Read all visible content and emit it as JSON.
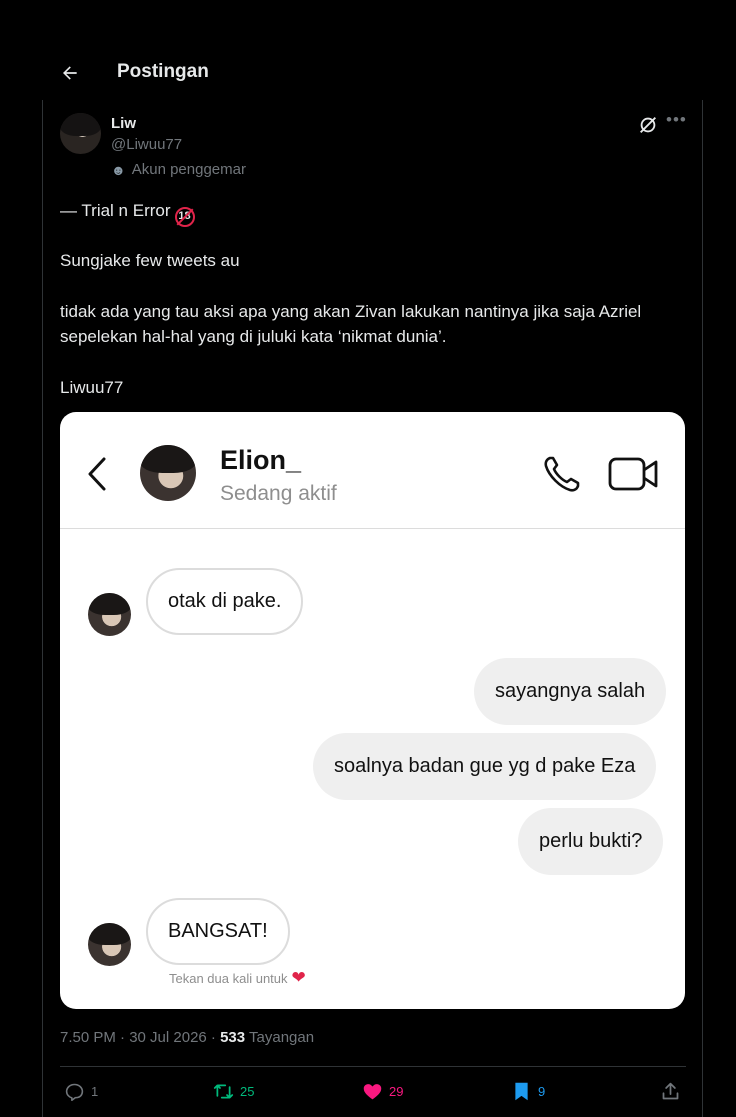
{
  "header": {
    "title": "Postingan"
  },
  "post": {
    "author_name": "Liw",
    "author_handle": "@Liwuu77",
    "author_label": "Akun penggemar",
    "line1": "— Trial n Error",
    "line1_badge": "18",
    "line2": "Sungjake few tweets au",
    "line3": "tidak ada yang tau aksi apa yang akan Zivan lakukan nantinya jika saja Azriel sepelekan hal-hal yang di juluki kata ‘nikmat dunia’.",
    "line4": "Liwuu77"
  },
  "chat": {
    "contact_name": "Elion_",
    "status": "Sedang aktif",
    "messages": [
      {
        "from": "them",
        "text": "otak di pake."
      },
      {
        "from": "me",
        "text": "sayangnya salah"
      },
      {
        "from": "me",
        "text": "soalnya badan gue yg d pake Eza"
      },
      {
        "from": "me",
        "text": "perlu bukti?"
      },
      {
        "from": "them",
        "text": "BANGSAT!"
      }
    ],
    "double_tap_hint": "Tekan dua kali untuk"
  },
  "meta": {
    "time_date": "7.50 PM · 30 Jul 2026 ·",
    "views_count": "533",
    "views_label": "Tayangan"
  },
  "actions": {
    "replies": "1",
    "reposts": "25",
    "likes": "29",
    "bookmarks": "9"
  },
  "colors": {
    "background": "#000000",
    "text": "#e7e9ea",
    "muted": "#71767b",
    "repost": "#00ba7c",
    "like": "#f91880",
    "bookmark": "#1d9bf0"
  }
}
